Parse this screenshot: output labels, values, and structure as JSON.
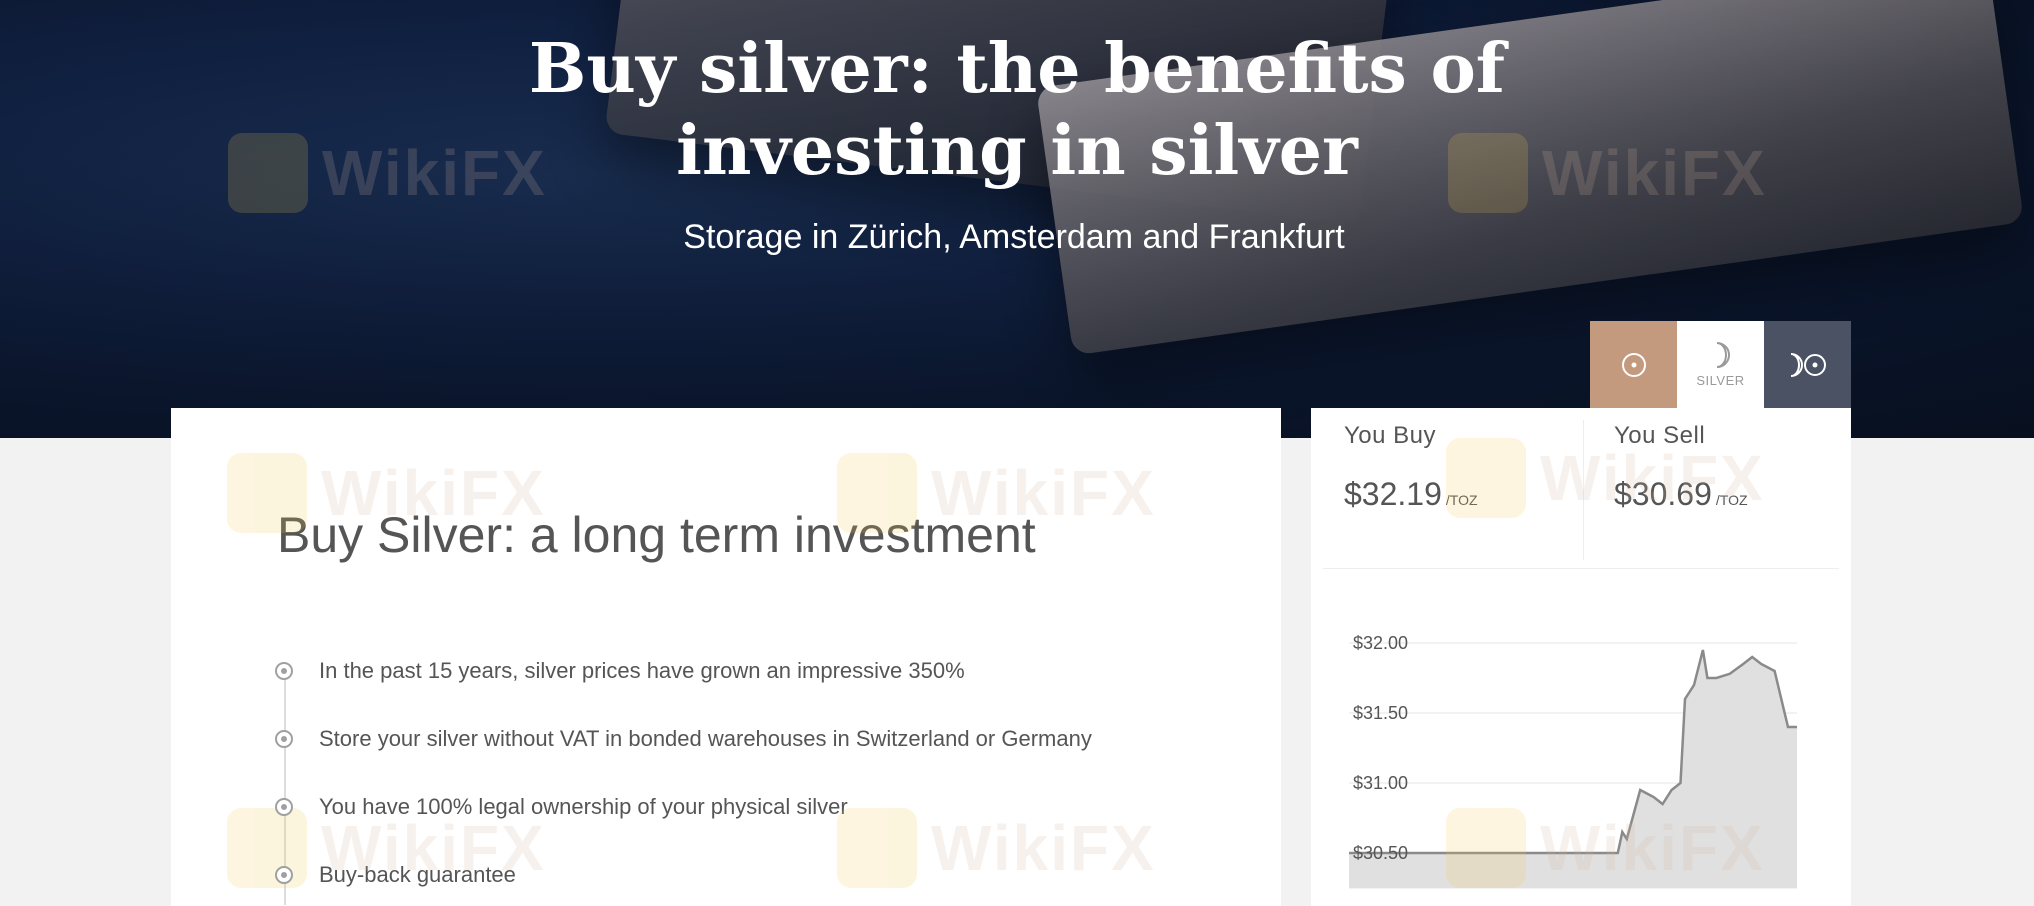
{
  "hero": {
    "title_line1": "Buy silver: the benefits of",
    "title_line2": "investing in silver",
    "subtitle": "Storage in Zürich, Amsterdam and Frankfurt"
  },
  "metal_tabs": {
    "gold_icon": "sun-circle-icon",
    "silver_icon": "moon-icon",
    "silver_label": "SILVER",
    "all_icon": "moon-sun-icon",
    "colors": {
      "gold": "#c49a7e",
      "silver": "#ffffff",
      "all": "#4a5264"
    }
  },
  "main": {
    "heading": "Buy Silver: a long term investment",
    "bullets": [
      "In the past 15 years, silver prices have grown an impressive 350%",
      "Store your silver without VAT in bonded warehouses in Switzerland or Germany",
      "You have 100% legal ownership of your physical silver",
      "Buy-back guarantee"
    ]
  },
  "prices": {
    "buy_label": "You Buy",
    "buy_value": "$32.19",
    "buy_unit": "/TOZ",
    "sell_label": "You Sell",
    "sell_value": "$30.69",
    "sell_unit": "/TOZ"
  },
  "watermark": "WikiFX",
  "chart_data": {
    "type": "area",
    "ylim": [
      30.25,
      32.25
    ],
    "yticks": [
      32.0,
      31.5,
      31.0,
      30.5
    ],
    "ytick_labels": [
      "$32.00",
      "$31.50",
      "$31.00",
      "$30.50"
    ],
    "x": [
      0,
      10,
      20,
      30,
      40,
      50,
      55,
      58,
      60,
      61,
      62,
      65,
      68,
      70,
      72,
      74,
      75,
      77,
      79,
      80,
      82,
      85,
      88,
      90,
      92,
      95,
      98,
      100
    ],
    "values": [
      30.5,
      30.5,
      30.5,
      30.5,
      30.5,
      30.5,
      30.5,
      30.5,
      30.5,
      30.65,
      30.6,
      30.95,
      30.9,
      30.85,
      30.95,
      31.0,
      31.6,
      31.7,
      31.95,
      31.75,
      31.75,
      31.78,
      31.85,
      31.9,
      31.85,
      31.8,
      31.4,
      31.4
    ],
    "grid": true,
    "color": "#8a8a8a",
    "fill": "#e0e0e0"
  }
}
